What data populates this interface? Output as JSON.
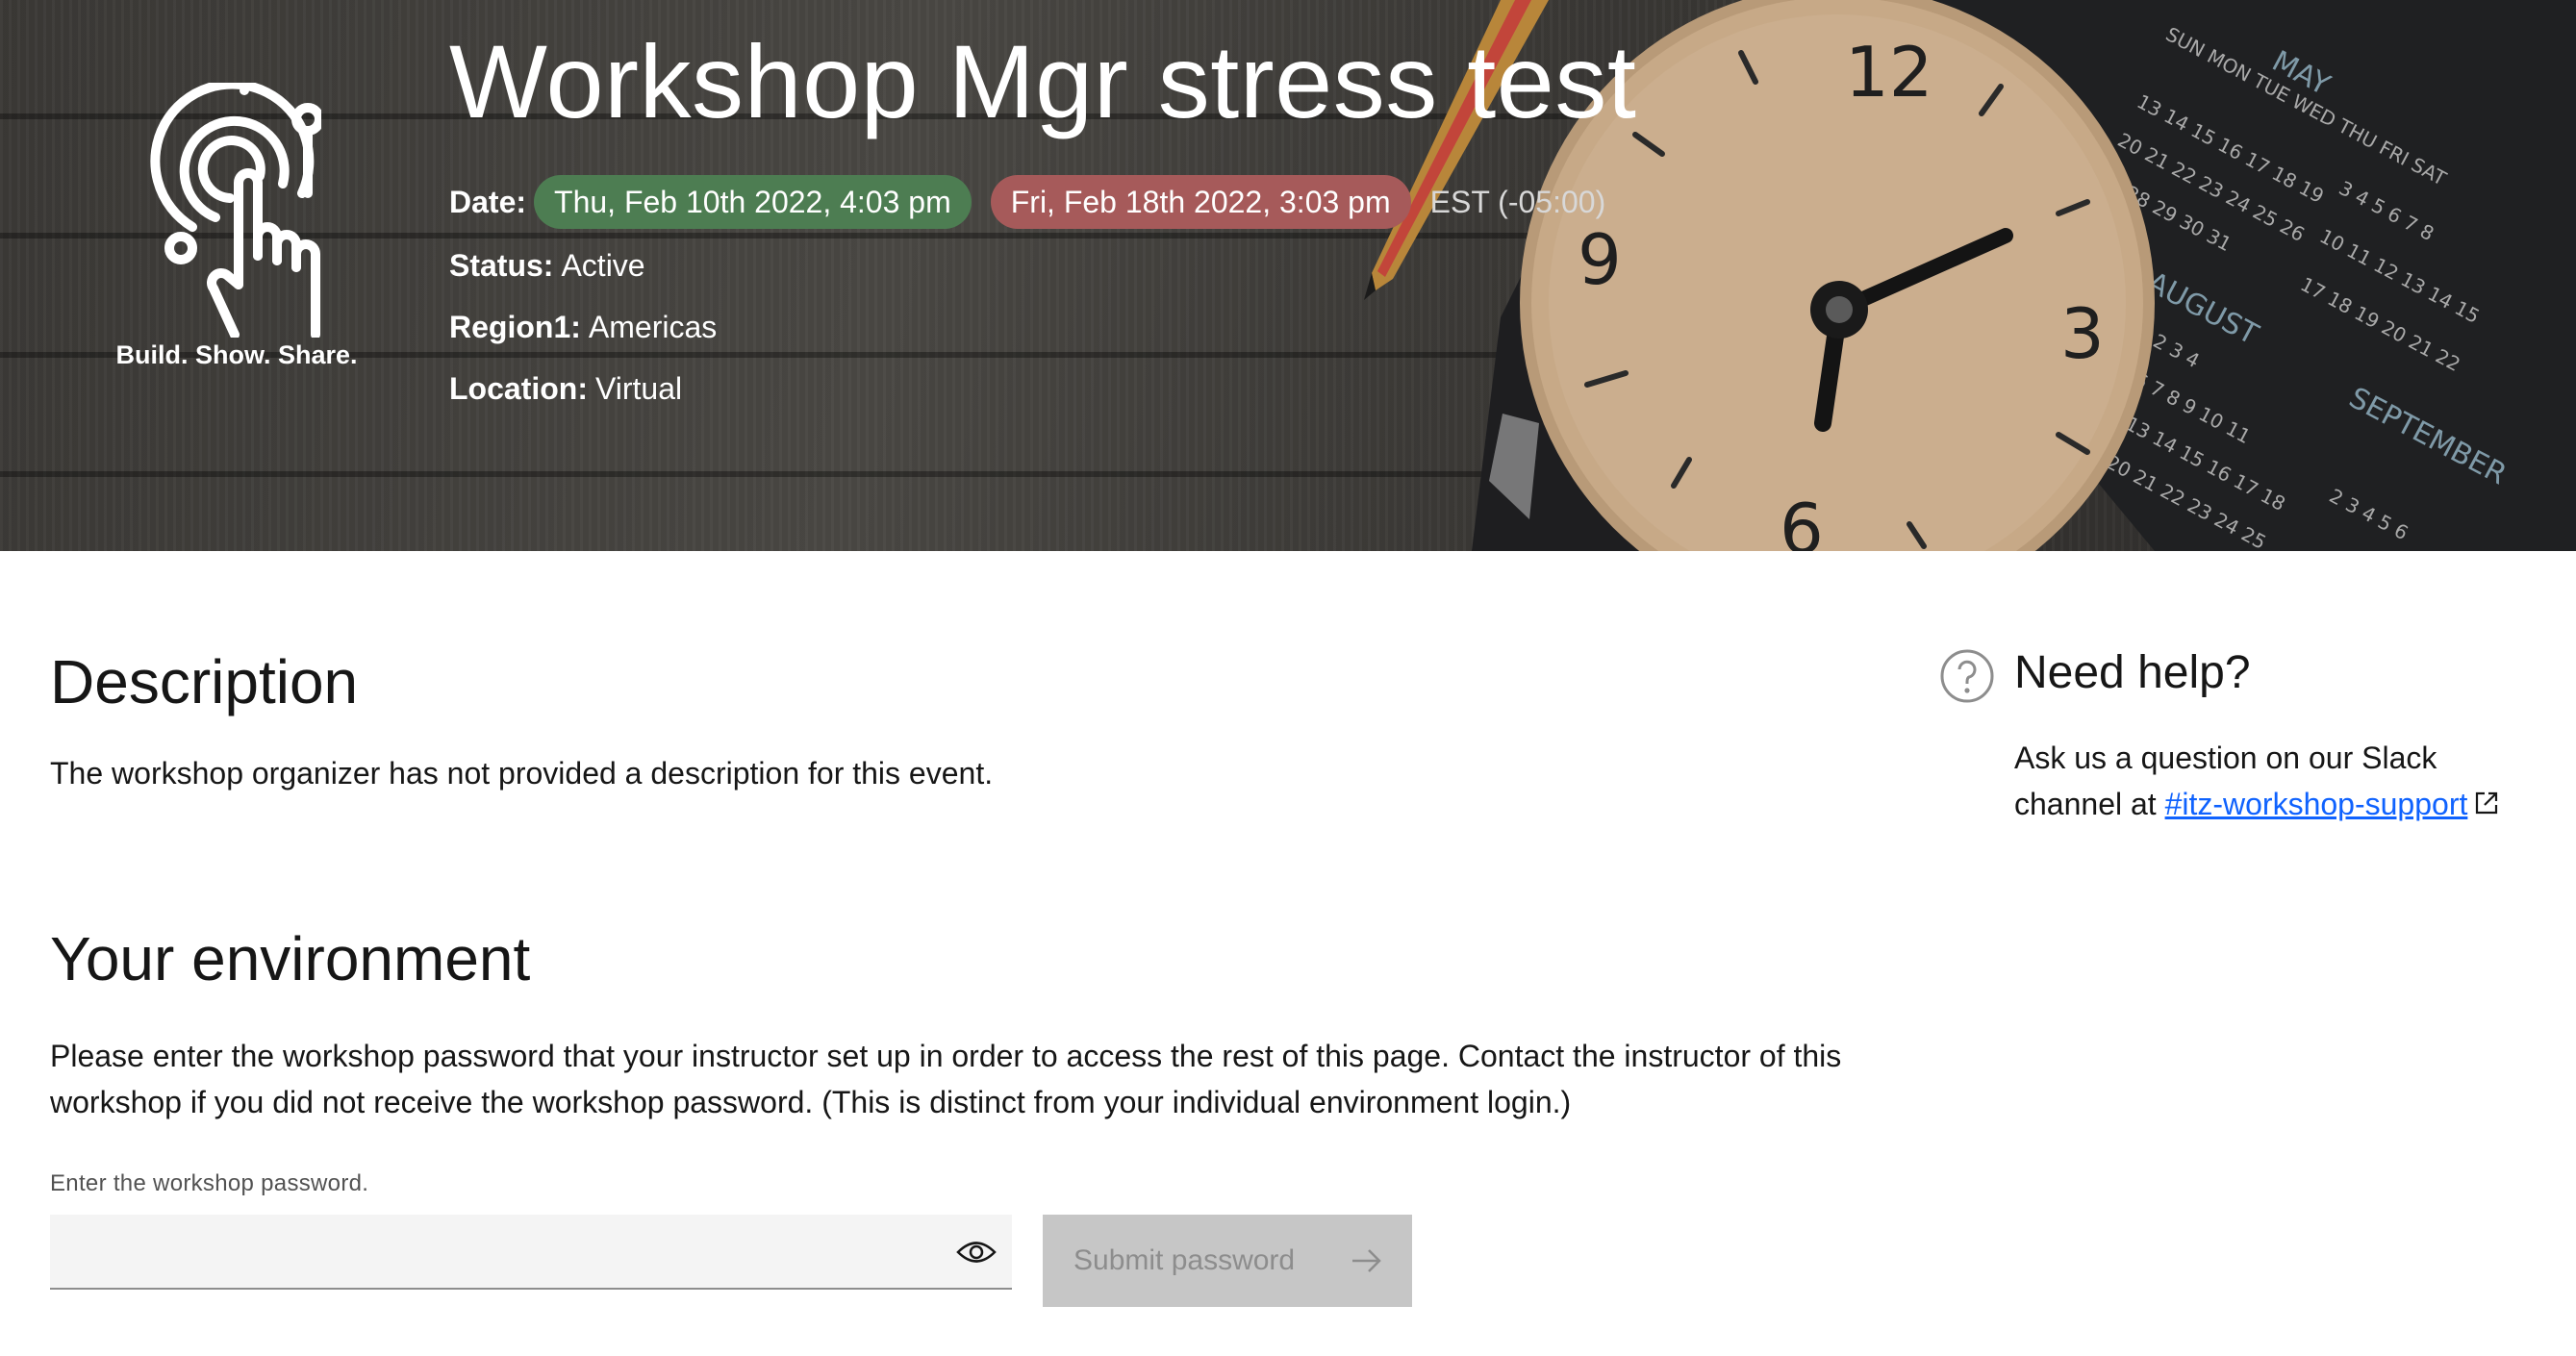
{
  "hero": {
    "tagline": "Build. Show. Share.",
    "title": "Workshop Mgr stress test",
    "date_label": "Date:",
    "start_date": "Thu, Feb 10th 2022, 4:03 pm",
    "end_date": "Fri, Feb 18th 2022, 3:03 pm",
    "timezone": "EST (-05:00)",
    "status_label": "Status:",
    "status_value": "Active",
    "region_label": "Region1:",
    "region_value": "Americas",
    "location_label": "Location:",
    "location_value": "Virtual"
  },
  "description": {
    "heading": "Description",
    "text": "The workshop organizer has not provided a description for this event."
  },
  "environment": {
    "heading": "Your environment",
    "text": "Please enter the workshop password that your instructor set up in order to access the rest of this page. Contact the instructor of this workshop if you did not receive the workshop password. (This is distinct from your individual environment login.)",
    "password_label": "Enter the workshop password.",
    "password_value": "",
    "submit_label": "Submit password"
  },
  "help": {
    "title": "Need help?",
    "text": "Ask us a question on our Slack channel at",
    "link_text": "#itz-workshop-support"
  },
  "colors": {
    "start_pill": "#4d7d52",
    "end_pill": "#a65a5a",
    "link": "#0f62fe",
    "button_disabled": "#c6c6c6"
  },
  "icons": [
    "touch-logo-icon",
    "eye-icon",
    "arrow-right-icon",
    "help-circle-icon",
    "external-link-icon"
  ]
}
